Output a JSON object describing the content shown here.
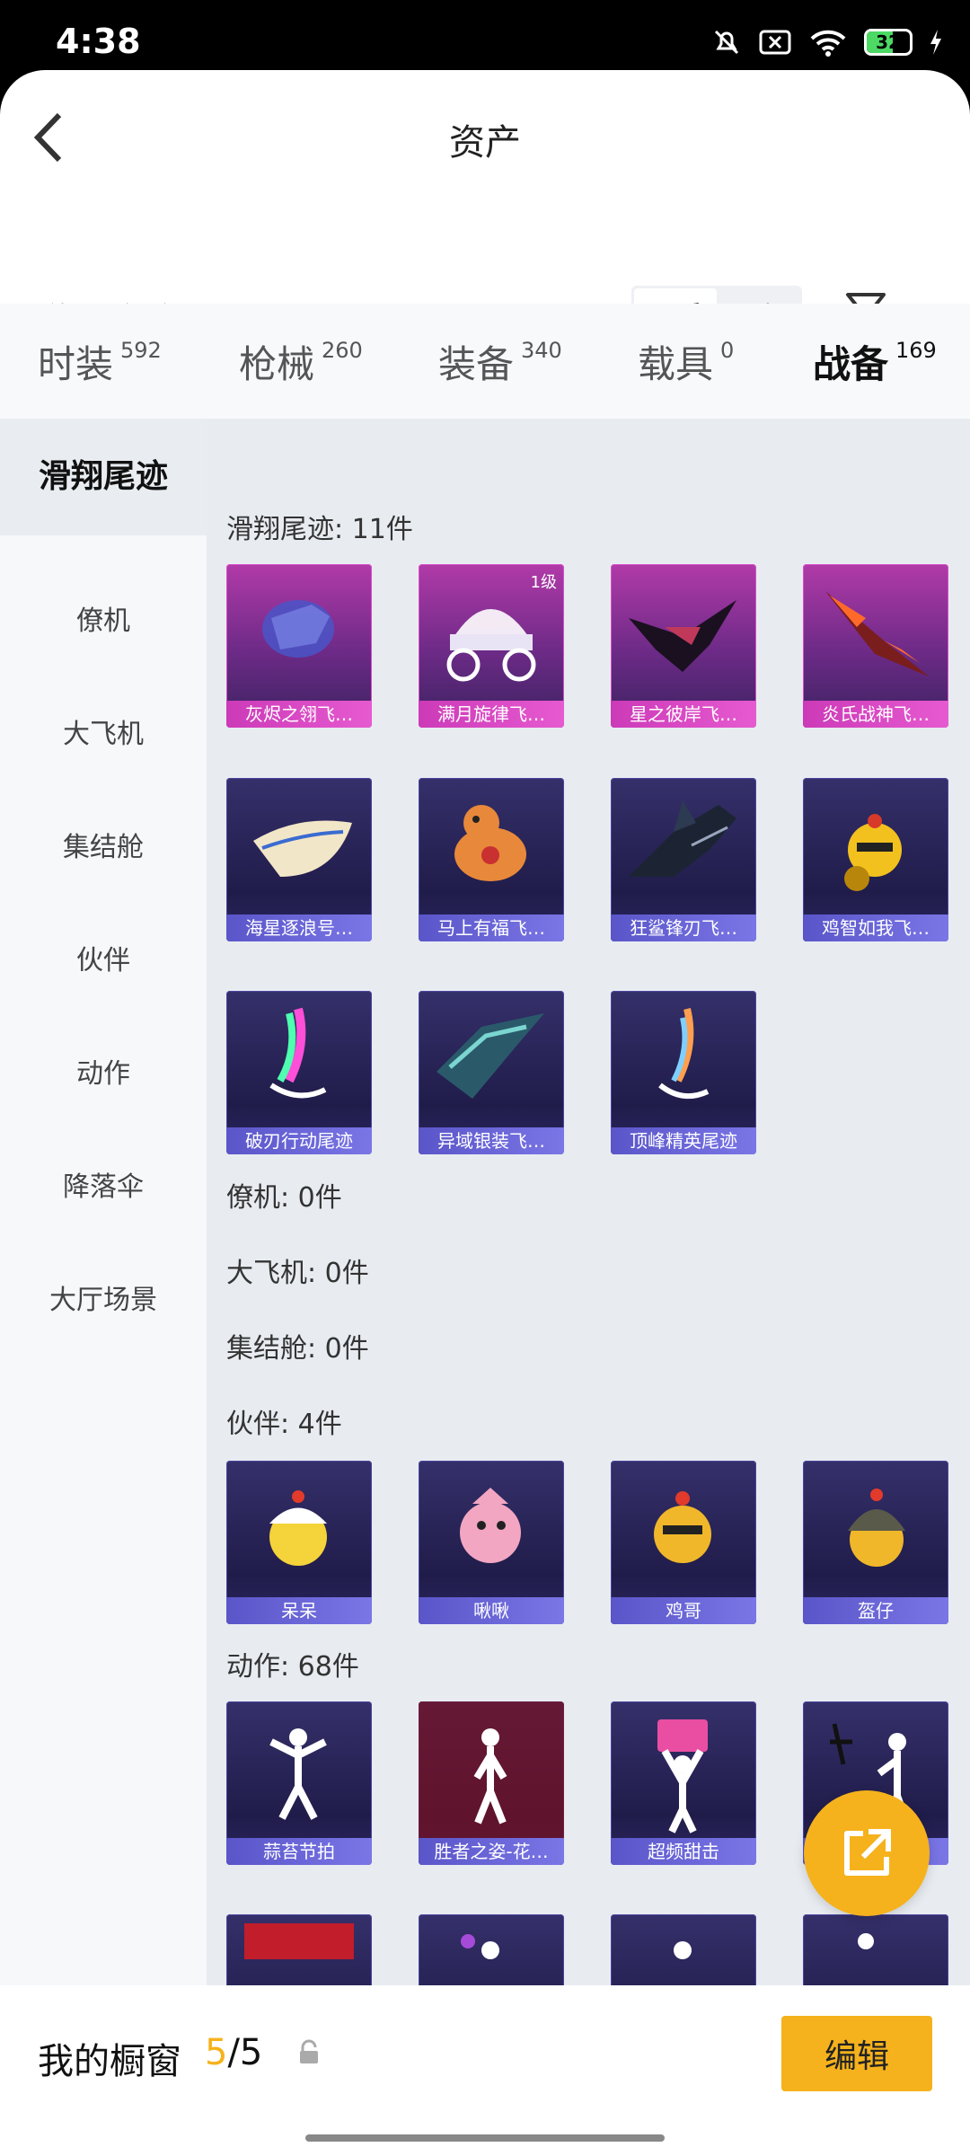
{
  "status_bar": {
    "time": "4:38",
    "battery": "32"
  },
  "header": {
    "title": "资产"
  },
  "warehouse": {
    "title": "游戏仓库",
    "sort_options": [
      "品质",
      "最新"
    ],
    "active_sort": "品质"
  },
  "tabs": [
    {
      "label": "时装",
      "count": "592"
    },
    {
      "label": "枪械",
      "count": "260"
    },
    {
      "label": "装备",
      "count": "340"
    },
    {
      "label": "载具",
      "count": "0"
    },
    {
      "label": "战备",
      "count": "169"
    }
  ],
  "sidebar": [
    "滑翔尾迹",
    "僚机",
    "大飞机",
    "集结舱",
    "伙伴",
    "动作",
    "降落伞",
    "大厅场景"
  ],
  "sections": {
    "glide_trail": {
      "label": "滑翔尾迹: 11件",
      "items": [
        {
          "name": "灰烬之翎飞…",
          "quality": "purple"
        },
        {
          "name": "满月旋律飞…",
          "quality": "purple",
          "level": "1级"
        },
        {
          "name": "星之彼岸飞…",
          "quality": "purple"
        },
        {
          "name": "炎氏战神飞…",
          "quality": "purple"
        },
        {
          "name": "海星逐浪号…",
          "quality": "blue"
        },
        {
          "name": "马上有福飞…",
          "quality": "blue"
        },
        {
          "name": "狂鲨锋刃飞…",
          "quality": "blue"
        },
        {
          "name": "鸡智如我飞…",
          "quality": "blue"
        },
        {
          "name": "破刃行动尾迹",
          "quality": "blue"
        },
        {
          "name": "异域银装飞…",
          "quality": "blue"
        },
        {
          "name": "顶峰精英尾迹",
          "quality": "blue"
        }
      ]
    },
    "wingman": {
      "label": "僚机: 0件"
    },
    "big_plane": {
      "label": "大飞机: 0件"
    },
    "capsule": {
      "label": "集结舱: 0件"
    },
    "partner": {
      "label": "伙伴: 4件",
      "items": [
        {
          "name": "呆呆"
        },
        {
          "name": "啾啾"
        },
        {
          "name": "鸡哥"
        },
        {
          "name": "盔仔"
        }
      ]
    },
    "emote": {
      "label": "动作: 68件",
      "items": [
        {
          "name": "蒜苔节拍"
        },
        {
          "name": "胜者之姿-花…"
        },
        {
          "name": "超频甜击"
        },
        {
          "name": ""
        }
      ]
    }
  },
  "showcase": {
    "title": "我的橱窗",
    "current": "5",
    "separator_total": "/5",
    "edit_label": "编辑"
  },
  "colors": {
    "accent": "#f5b21c",
    "purple_card": "#b13aa8",
    "blue_card": "#35306a"
  }
}
